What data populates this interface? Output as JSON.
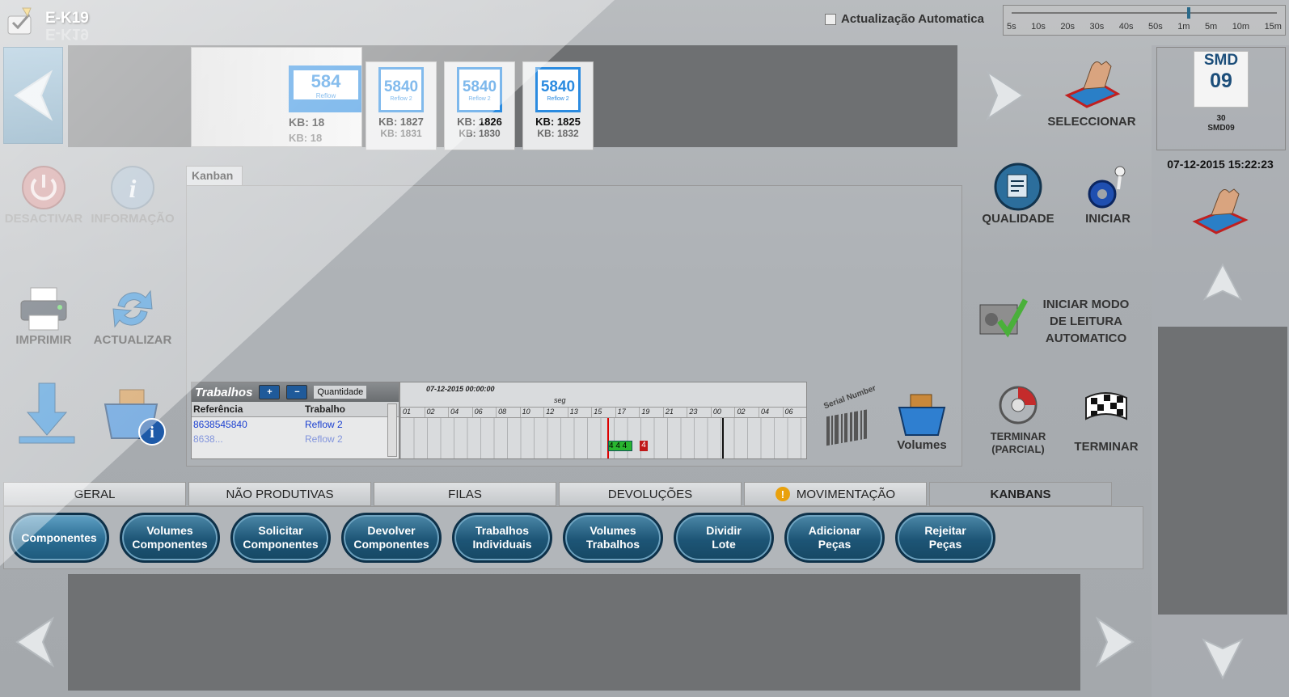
{
  "app": {
    "title": "E-K19"
  },
  "header": {
    "auto_update_label": "Actualização Automatica",
    "interval_ticks": [
      "5s",
      "10s",
      "20s",
      "30s",
      "40s",
      "50s",
      "1m",
      "5m",
      "10m",
      "15m"
    ],
    "interval_selected": "1m"
  },
  "top_strip": {
    "cards": [
      {
        "number": "584",
        "sub": "Reflow",
        "kb": "KB: 18",
        "kb_next": "KB: 18"
      },
      {
        "number": "5840",
        "sub": "Reflow 2",
        "kb": "KB: 1827",
        "kb_next": "KB: 1831"
      },
      {
        "number": "5840",
        "sub": "Reflow 2",
        "kb": "KB: 1826",
        "kb_next": "KB: 1830"
      },
      {
        "number": "5840",
        "sub": "Reflow 2",
        "kb": "KB: 1825",
        "kb_next": "KB: 1832"
      }
    ],
    "select_label": "SELECCIONAR"
  },
  "line_panel": {
    "code": "SMD",
    "number": "09",
    "small_number": "30",
    "small_code": "SMD09",
    "datetime": "07-12-2015 15:22:23"
  },
  "left_actions": {
    "deactivate": "DESACTIVAR",
    "info": "INFORMAÇÃO",
    "print": "IMPRIMIR",
    "refresh": "ACTUALIZAR"
  },
  "right_actions": {
    "quality": "QUALIDADE",
    "start": "INICIAR",
    "auto_read": "INICIAR MODO DE LEITURA AUTOMATICO",
    "finish_partial_1": "TERMINAR",
    "finish_partial_2": "(PARCIAL)",
    "finish": "TERMINAR",
    "volumes": "Volumes",
    "serial_number": "Serial Number"
  },
  "kanban_panel": {
    "tab_label": "Kanban"
  },
  "jobs": {
    "title": "Trabalhos",
    "quantity_label": "Quantidade",
    "columns": [
      "Referência",
      "Trabalho"
    ],
    "rows": [
      {
        "reference": "8638545840",
        "job": "Reflow 2"
      },
      {
        "reference": "8638...",
        "job": "Reflow 2"
      }
    ]
  },
  "gantt": {
    "date": "07-12-2015 00:00:00",
    "day": "seg",
    "hours": [
      "01",
      "02",
      "04",
      "06",
      "08",
      "10",
      "12",
      "13",
      "15",
      "17",
      "19",
      "21",
      "23",
      "00",
      "02",
      "04",
      "06"
    ],
    "green_label": "4 4 4",
    "red_label": "4"
  },
  "tabs": [
    {
      "label": "GERAL",
      "active": false,
      "warning": false
    },
    {
      "label": "NÃO PRODUTIVAS",
      "active": false,
      "warning": false
    },
    {
      "label": "FILAS",
      "active": false,
      "warning": false
    },
    {
      "label": "DEVOLUÇÕES",
      "active": false,
      "warning": false
    },
    {
      "label": "MOVIMENTAÇÃO",
      "active": false,
      "warning": true
    },
    {
      "label": "KANBANS",
      "active": true,
      "warning": false
    }
  ],
  "buttons": [
    {
      "l1": "Componentes",
      "l2": ""
    },
    {
      "l1": "Volumes",
      "l2": "Componentes"
    },
    {
      "l1": "Solicitar",
      "l2": "Componentes"
    },
    {
      "l1": "Devolver",
      "l2": "Componentes"
    },
    {
      "l1": "Trabalhos",
      "l2": "Individuais"
    },
    {
      "l1": "Volumes",
      "l2": "Trabalhos"
    },
    {
      "l1": "Dividir",
      "l2": "Lote"
    },
    {
      "l1": "Adicionar",
      "l2": "Peças"
    },
    {
      "l1": "Rejeitar",
      "l2": "Peças"
    }
  ]
}
